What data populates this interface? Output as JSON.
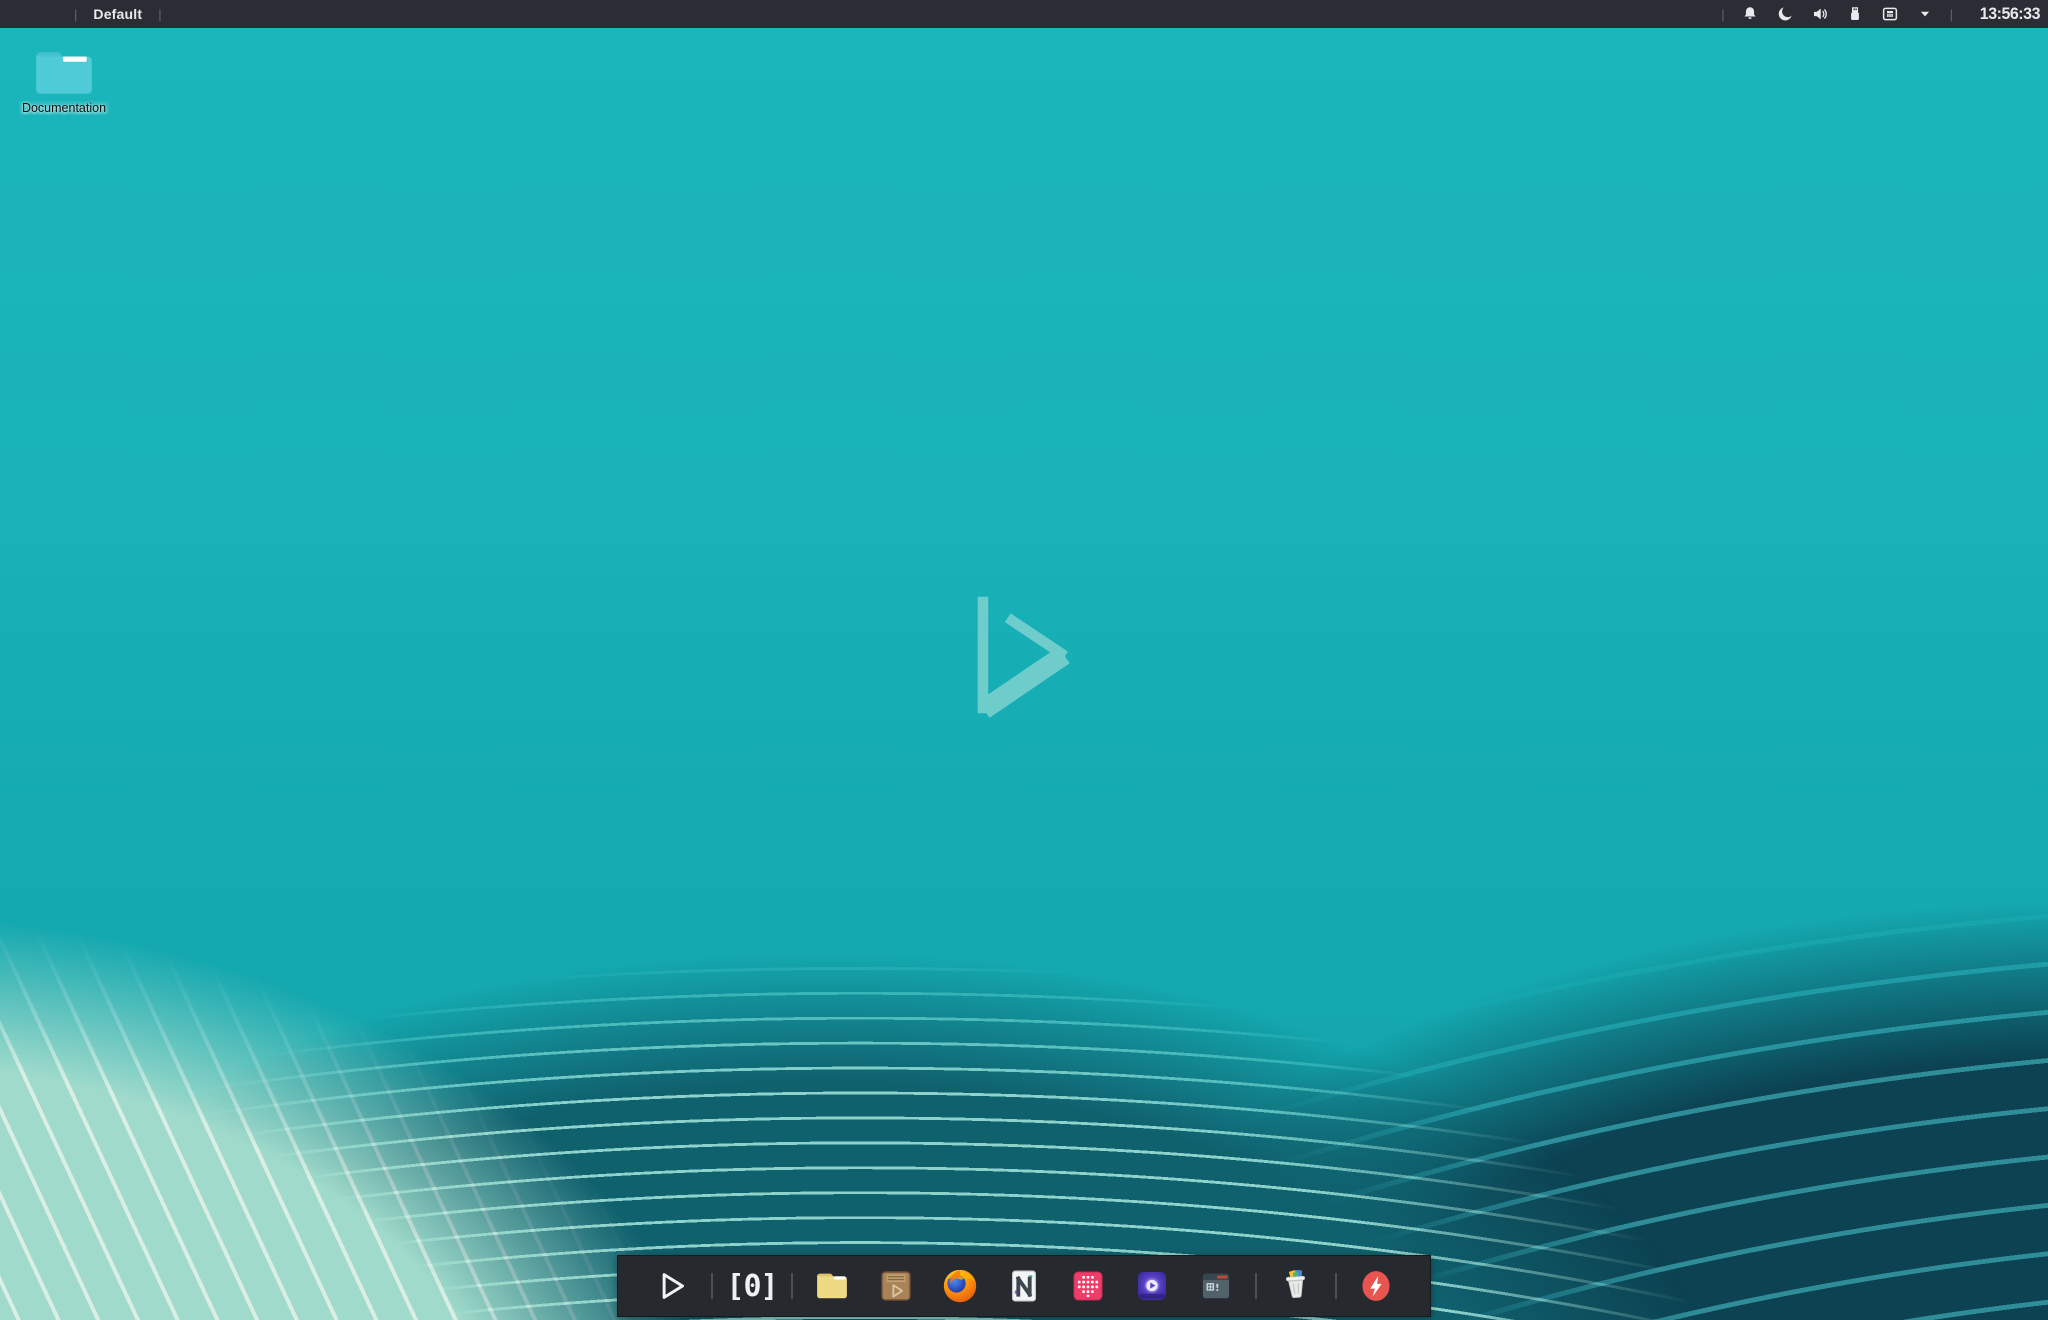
{
  "panel": {
    "workspace_label": "Default",
    "separator_glyph": "|",
    "clock": "13:56:33",
    "tray_icons": [
      "bell-icon",
      "night-light-icon",
      "volume-icon",
      "removable-drive-icon",
      "network-port-icon",
      "caret-down-icon"
    ]
  },
  "desktop": {
    "icons": [
      {
        "label": "Documentation",
        "type": "folder"
      }
    ],
    "watermark": "play-triangle-outline"
  },
  "dock": {
    "workspace_indicator": "[0]",
    "items": [
      {
        "name": "launcher",
        "icon": "play-outline-icon"
      },
      {
        "name": "workspace-indicator",
        "icon": "text"
      },
      {
        "name": "file-manager",
        "icon": "yellow-folder-icon"
      },
      {
        "name": "package-manager",
        "icon": "brown-package-icon"
      },
      {
        "name": "firefox",
        "icon": "firefox-icon"
      },
      {
        "name": "notes",
        "icon": "white-n-document-icon"
      },
      {
        "name": "music-grid",
        "icon": "pink-dot-grid-icon"
      },
      {
        "name": "media-player",
        "icon": "purple-play-icon"
      },
      {
        "name": "terminal",
        "icon": "terminal-window-icon"
      },
      {
        "name": "trash",
        "icon": "trash-full-icon"
      },
      {
        "name": "updater",
        "icon": "red-lightning-icon"
      }
    ]
  },
  "colors": {
    "wallpaper_teal": "#18b2b8",
    "wave_dark": "#0c4252",
    "wave_light": "#d9efe4",
    "panel_bg": "#2a2d33",
    "dock_bg": "#26292d",
    "desktop_folder": "#4ecbd6",
    "dock_folder": "#eed984",
    "firefox_orange": "#f57e17",
    "pink_app": "#ee3d69",
    "media_purple": "#4a35b4",
    "updater_red": "#e85450"
  }
}
